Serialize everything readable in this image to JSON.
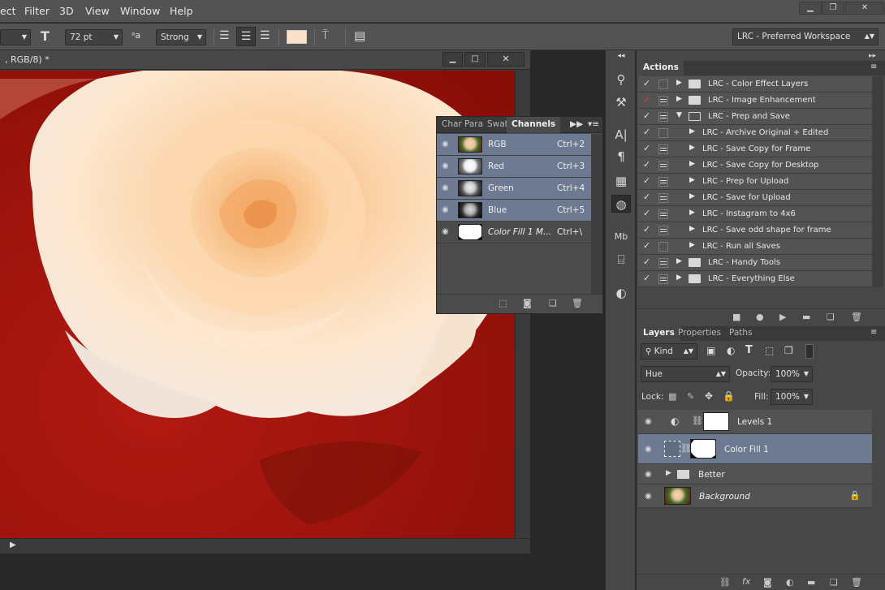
{
  "menu": {
    "items": [
      "ect",
      "Filter",
      "3D",
      "View",
      "Window",
      "Help"
    ]
  },
  "options": {
    "font_size": "72 pt",
    "aa_label": "a",
    "antialias": "Strong",
    "workspace": "LRC - Preferred Workspace",
    "color_swatch": "#fde0c8"
  },
  "document": {
    "title": ", RGB/8) *"
  },
  "channels": {
    "tabs": [
      "Char",
      "Para",
      "Swat",
      "Channels"
    ],
    "rows": [
      {
        "name": "RGB",
        "key": "Ctrl+2",
        "selected": true
      },
      {
        "name": "Red",
        "key": "Ctrl+3",
        "selected": true
      },
      {
        "name": "Green",
        "key": "Ctrl+4",
        "selected": true
      },
      {
        "name": "Blue",
        "key": "Ctrl+5",
        "selected": true
      },
      {
        "name": "Color Fill 1 M...",
        "key": "Ctrl+\\",
        "selected": false
      }
    ]
  },
  "actions": {
    "tab": "Actions",
    "items": [
      {
        "label": "LRC - Color Effect Layers",
        "level": 0,
        "folder": true,
        "open": false,
        "box": false,
        "red": false
      },
      {
        "label": "LRC - Image Enhancement",
        "level": 0,
        "folder": true,
        "open": false,
        "box": true,
        "red": true
      },
      {
        "label": "LRC - Prep and Save",
        "level": 0,
        "folder": true,
        "open": true,
        "box": true,
        "red": false
      },
      {
        "label": "LRC - Archive Original + Edited",
        "level": 1,
        "folder": false,
        "box": false,
        "red": false
      },
      {
        "label": "LRC - Save Copy for Frame",
        "level": 1,
        "folder": false,
        "box": true,
        "red": false
      },
      {
        "label": "LRC - Save Copy for Desktop",
        "level": 1,
        "folder": false,
        "box": true,
        "red": false
      },
      {
        "label": "LRC - Prep for Upload",
        "level": 1,
        "folder": false,
        "box": true,
        "red": false
      },
      {
        "label": "LRC - Save for Upload",
        "level": 1,
        "folder": false,
        "box": true,
        "red": false
      },
      {
        "label": "LRC - Instagram to 4x6",
        "level": 1,
        "folder": false,
        "box": true,
        "red": false
      },
      {
        "label": "LRC - Save odd shape for frame",
        "level": 1,
        "folder": false,
        "box": true,
        "red": false
      },
      {
        "label": "LRC - Run all Saves",
        "level": 1,
        "folder": false,
        "box": false,
        "red": false
      },
      {
        "label": "LRC - Handy Tools",
        "level": 0,
        "folder": true,
        "open": false,
        "box": true,
        "red": false
      },
      {
        "label": "LRC - Everything Else",
        "level": 0,
        "folder": true,
        "open": false,
        "box": true,
        "red": false
      }
    ]
  },
  "layers": {
    "tabs": [
      "Layers",
      "Properties",
      "Paths"
    ],
    "filter": "Kind",
    "blend": "Hue",
    "opacity_label": "Opacity:",
    "opacity": "100%",
    "lock_label": "Lock:",
    "fill_label": "Fill:",
    "fill": "100%",
    "items": [
      {
        "name": "Levels 1"
      },
      {
        "name": "Color Fill 1"
      },
      {
        "name": "Better"
      },
      {
        "name": "Background"
      }
    ]
  }
}
